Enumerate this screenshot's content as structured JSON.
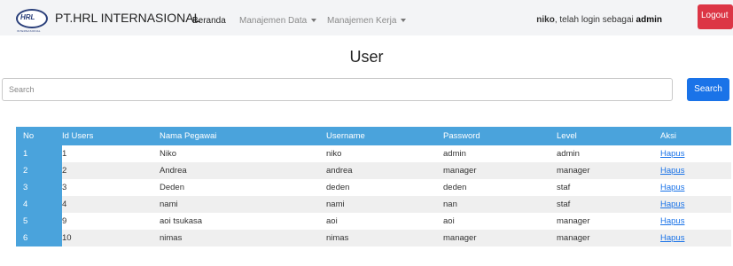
{
  "navbar": {
    "logo_text": "HRL",
    "logo_sub": "INTERNASIONAL",
    "brand": "PT.HRL INTERNASIONAL",
    "items": [
      {
        "label": "Beranda"
      },
      {
        "label": "Manajemen Data"
      },
      {
        "label": "Manajemen Kerja"
      }
    ],
    "login_user": "niko",
    "login_text": ", telah login sebagai ",
    "login_level": "admin",
    "logout_label": "Logout"
  },
  "page": {
    "title": "User"
  },
  "search": {
    "placeholder": "Search",
    "button_label": "Search"
  },
  "table": {
    "headers": [
      "No",
      "Id Users",
      "Nama Pegawai",
      "Username",
      "Password",
      "Level",
      "Aksi"
    ],
    "rows": [
      {
        "no": "1",
        "id": "1",
        "nama": "Niko",
        "username": "niko",
        "password": "admin",
        "level": "admin",
        "aksi": "Hapus"
      },
      {
        "no": "2",
        "id": "2",
        "nama": "Andrea",
        "username": "andrea",
        "password": "manager",
        "level": "manager",
        "aksi": "Hapus"
      },
      {
        "no": "3",
        "id": "3",
        "nama": "Deden",
        "username": "deden",
        "password": "deden",
        "level": "staf",
        "aksi": "Hapus"
      },
      {
        "no": "4",
        "id": "4",
        "nama": "nami",
        "username": "nami",
        "password": "nan",
        "level": "staf",
        "aksi": "Hapus"
      },
      {
        "no": "5",
        "id": "9",
        "nama": "aoi tsukasa",
        "username": "aoi",
        "password": "aoi",
        "level": "manager",
        "aksi": "Hapus"
      },
      {
        "no": "6",
        "id": "10",
        "nama": "nimas",
        "username": "nimas",
        "password": "manager",
        "level": "manager",
        "aksi": "Hapus"
      }
    ]
  },
  "colors": {
    "header_bg": "#4aa3dc",
    "logout": "#dc3545",
    "primary": "#1a73e8"
  }
}
